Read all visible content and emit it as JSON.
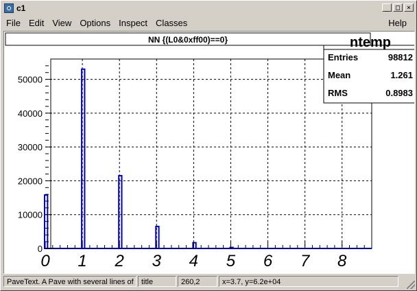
{
  "window": {
    "title": "c1"
  },
  "menubar": {
    "items": [
      "File",
      "Edit",
      "View",
      "Options",
      "Inspect",
      "Classes"
    ],
    "help": "Help"
  },
  "window_buttons": {
    "minimize": "_",
    "maximize": "□",
    "close": "×"
  },
  "plot": {
    "title": "NN {(L0&0xff00)==0}",
    "stats": {
      "name": "ntemp",
      "rows": [
        {
          "label": "Entries",
          "value": "98812"
        },
        {
          "label": "Mean",
          "value": "1.261"
        },
        {
          "label": "RMS",
          "value": "0.8983"
        }
      ]
    }
  },
  "chart_data": {
    "type": "bar",
    "title": "NN {(L0&0xff00)==0}",
    "xlabel": "",
    "ylabel": "",
    "xlim": [
      0,
      8.8
    ],
    "ylim": [
      0,
      56000
    ],
    "x_ticks": [
      "0",
      "1",
      "2",
      "3",
      "4",
      "5",
      "6",
      "7",
      "8"
    ],
    "y_ticks": [
      "0",
      "10000",
      "20000",
      "30000",
      "40000",
      "50000"
    ],
    "grid": true,
    "bars": [
      {
        "x": 0,
        "value": 15800
      },
      {
        "x": 1,
        "value": 53000
      },
      {
        "x": 2,
        "value": 21500
      },
      {
        "x": 3,
        "value": 6500
      },
      {
        "x": 4,
        "value": 1700
      },
      {
        "x": 5,
        "value": 300
      }
    ],
    "bar_color": "#0000cc"
  },
  "status": {
    "object_info": "PaveText. A Pave with several lines of te",
    "object_name": "title",
    "pixel": "260,2",
    "coords": "x=3.7, y=6.2e+04"
  }
}
